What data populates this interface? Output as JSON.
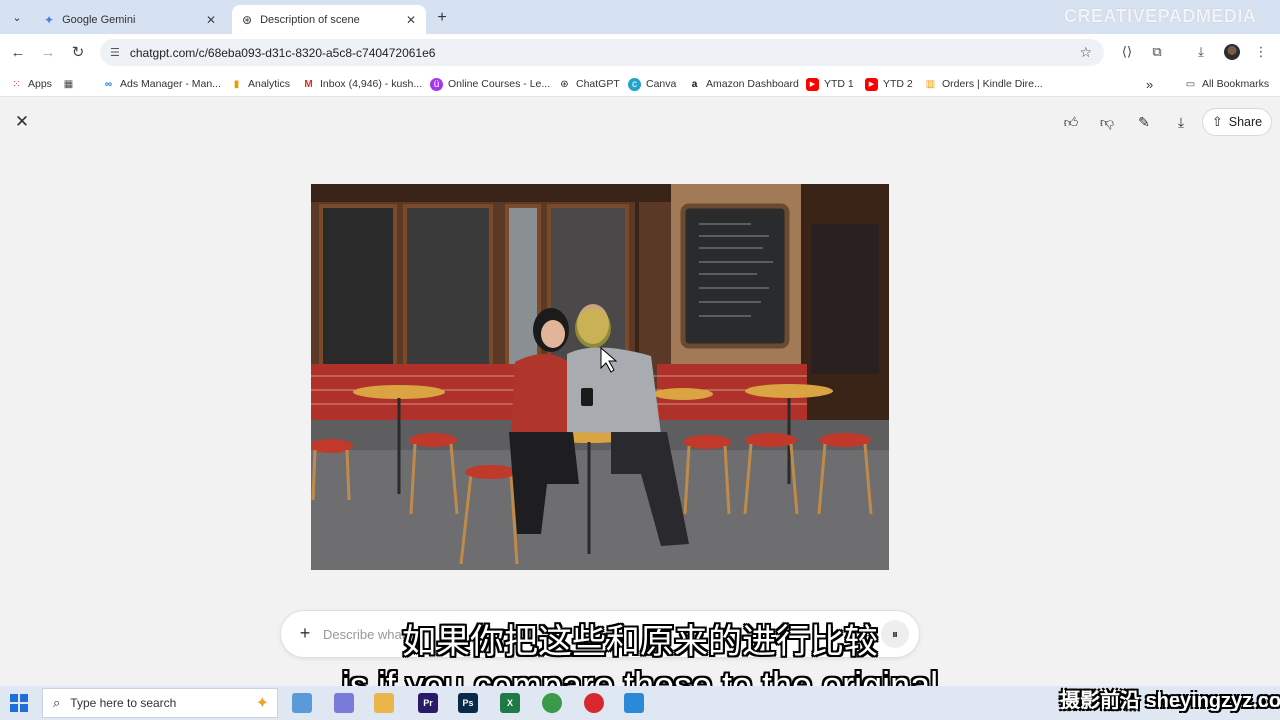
{
  "browser": {
    "tabs": [
      {
        "title": "Google Gemini",
        "icon": "gemini-sparkle-icon",
        "active": false
      },
      {
        "title": "Description of scene",
        "icon": "chatgpt-icon",
        "active": true
      }
    ],
    "url": "chatgpt.com/c/68eba093-d31c-8320-a5c8-c740472061e6",
    "watermark": "CREATIVEPADMEDIA"
  },
  "bookmarks": [
    {
      "label": "Apps",
      "icon": "apps-grid-icon"
    },
    {
      "label": "",
      "icon": "grid-icon"
    },
    {
      "label": "Ads Manager - Man...",
      "icon": "meta-icon"
    },
    {
      "label": "Analytics",
      "icon": "analytics-icon"
    },
    {
      "label": "Inbox (4,946) - kush...",
      "icon": "gmail-icon"
    },
    {
      "label": "Online Courses - Le...",
      "icon": "udemy-icon"
    },
    {
      "label": "ChatGPT",
      "icon": "chatgpt-icon"
    },
    {
      "label": "Canva",
      "icon": "canva-icon"
    },
    {
      "label": "Amazon Dashboard",
      "icon": "amazon-icon"
    },
    {
      "label": "YTD 1",
      "icon": "youtube-icon"
    },
    {
      "label": "YTD 2",
      "icon": "youtube-icon"
    },
    {
      "label": "Orders | Kindle Dire...",
      "icon": "kindle-icon"
    }
  ],
  "bookmarks_more": "»",
  "all_bookmarks": "All Bookmarks",
  "viewer": {
    "share_label": "Share"
  },
  "composer": {
    "placeholder": "Describe what"
  },
  "subtitles": {
    "zh": "如果你把这些和原来的进行比较",
    "en": "is if you compare these to the original"
  },
  "taskbar": {
    "search_placeholder": "Type here to search"
  },
  "site_watermark": "摄影前沿 sheyingzyz.com",
  "colors": {
    "tabstrip": "#d6e2f2",
    "accent_blue": "#1e6fd9",
    "cafe_red": "#c0392b"
  }
}
